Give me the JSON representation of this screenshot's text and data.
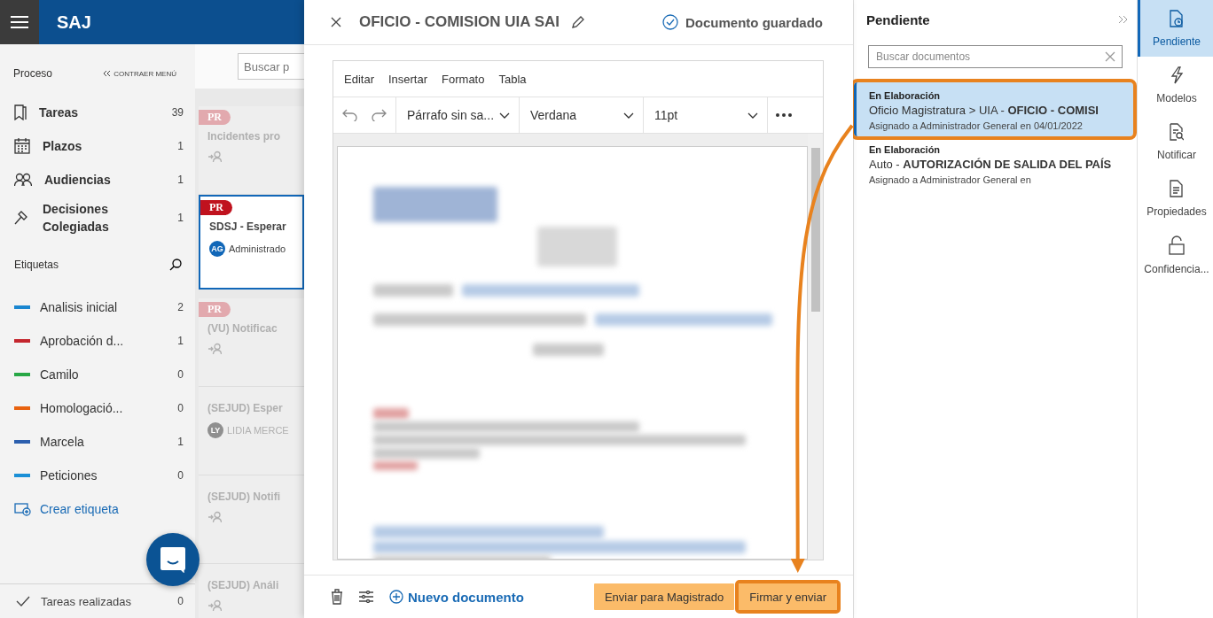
{
  "app": {
    "title": "SAJ"
  },
  "sidebar": {
    "section_title": "Proceso",
    "collapse_label": "CONTRAER MENÚ",
    "items": [
      {
        "label": "Tareas",
        "count": "39"
      },
      {
        "label": "Plazos",
        "count": "1"
      },
      {
        "label": "Audiencias",
        "count": "1"
      },
      {
        "label": "Decisiones Colegiadas",
        "count": "1"
      }
    ],
    "tags_title": "Etiquetas",
    "tags": [
      {
        "label": "Analisis inicial",
        "count": "2",
        "color": "#1a86d0"
      },
      {
        "label": "Aprobación d...",
        "count": "1",
        "color": "#c4262e"
      },
      {
        "label": "Camilo",
        "count": "0",
        "color": "#27a745"
      },
      {
        "label": "Homologació...",
        "count": "0",
        "color": "#e8620f"
      },
      {
        "label": "Marcela",
        "count": "1",
        "color": "#2c5fae"
      },
      {
        "label": "Peticiones",
        "count": "0",
        "color": "#1a8fd6"
      }
    ],
    "create_tag": "Crear etiqueta",
    "footer": {
      "label": "Tareas realizadas",
      "count": "0"
    }
  },
  "task_list": {
    "search_placeholder": "Buscar p",
    "cards": [
      {
        "badge": "PR",
        "title": "Incidentes pro",
        "selected": false
      },
      {
        "badge": "PR",
        "title": "SDSJ - Esperar",
        "initials": "AG",
        "assignee": "Administrado",
        "selected": true
      },
      {
        "badge": "PR",
        "title": "(VU) Notificac",
        "selected": false
      },
      {
        "title": "(SEJUD) Esper",
        "initials": "LY",
        "assignee": "LIDIA MERCE",
        "selected": false
      },
      {
        "title": "(SEJUD) Notifi",
        "selected": false
      },
      {
        "title": "(SEJUD) Análi",
        "selected": false
      }
    ]
  },
  "editor": {
    "title": "OFICIO - COMISION UIA SAI",
    "status": "Documento guardado",
    "menu": [
      "Editar",
      "Insertar",
      "Formato",
      "Tabla"
    ],
    "paragraph_style": "Párrafo sin sa...",
    "font": "Verdana",
    "font_size": "11pt",
    "new_document": "Nuevo documento",
    "buttons": [
      {
        "label": "Enviar para Magistrado",
        "highlighted": false
      },
      {
        "label": "Firmar y enviar",
        "highlighted": true
      }
    ]
  },
  "documents_panel": {
    "title": "Pendiente",
    "search_placeholder": "Buscar documentos",
    "documents": [
      {
        "status": "En Elaboración",
        "path": "Oficio Magistratura > UIA - **OFICIO - COMISI**",
        "assigned": "Asignado a Administrador General en 04/01/2022",
        "selected": true,
        "highlighted": true
      },
      {
        "status": "En Elaboración",
        "path": "Auto - **AUTORIZACIÓN DE SALIDA DEL PAÍS**",
        "assigned": "Asignado a Administrador General en",
        "selected": false,
        "highlighted": false
      }
    ]
  },
  "rail": [
    {
      "label": "Pendiente",
      "selected": true
    },
    {
      "label": "Modelos",
      "selected": false
    },
    {
      "label": "Notificar",
      "selected": false
    },
    {
      "label": "Propiedades",
      "selected": false
    },
    {
      "label": "Confidencia...",
      "selected": false
    }
  ],
  "callout": {
    "arrow": true
  }
}
